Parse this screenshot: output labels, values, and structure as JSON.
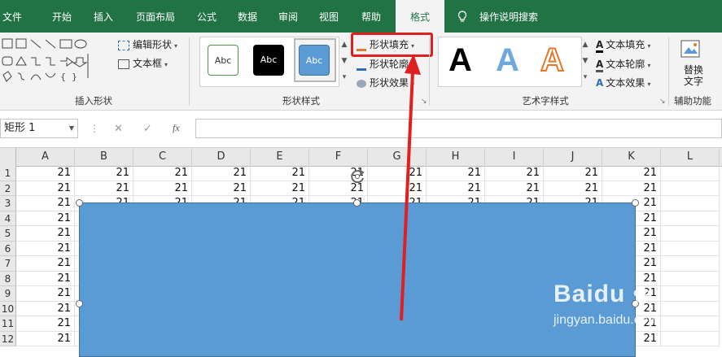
{
  "tabs": [
    "文件",
    "开始",
    "插入",
    "页面布局",
    "公式",
    "数据",
    "审阅",
    "视图",
    "帮助",
    "格式"
  ],
  "active_tab": "格式",
  "tell_me": "操作说明搜索",
  "groups": {
    "insert_shapes": {
      "label": "插入形状",
      "edit_shape": "编辑形状",
      "text_box": "文本框"
    },
    "shape_styles": {
      "label": "形状样式",
      "preset_text": "Abc",
      "fill": "形状填充",
      "outline": "形状轮廓",
      "effects": "形状效果"
    },
    "wordart": {
      "label": "艺术字样式",
      "glyph": "A",
      "text_fill": "文本填充",
      "text_outline": "文本轮廓",
      "text_effects": "文本效果"
    },
    "accessibility": {
      "label": "辅助功能",
      "alt_text_1": "替换",
      "alt_text_2": "文字"
    }
  },
  "formula_bar": {
    "name_box": "矩形 1",
    "cancel": "✕",
    "enter": "✓",
    "fx": "fx",
    "formula": ""
  },
  "columns": [
    "A",
    "B",
    "C",
    "D",
    "E",
    "F",
    "G",
    "H",
    "I",
    "J",
    "K",
    "L"
  ],
  "rows": [
    "1",
    "2",
    "3",
    "4",
    "5",
    "6",
    "7",
    "8",
    "9",
    "10",
    "11",
    "12"
  ],
  "cell_value": "21",
  "shape_fill_color": "#5b9bd5",
  "highlight_color": "#e02020",
  "watermark": {
    "brand": "Baidu",
    "sub": "jingyan.baidu.com"
  }
}
